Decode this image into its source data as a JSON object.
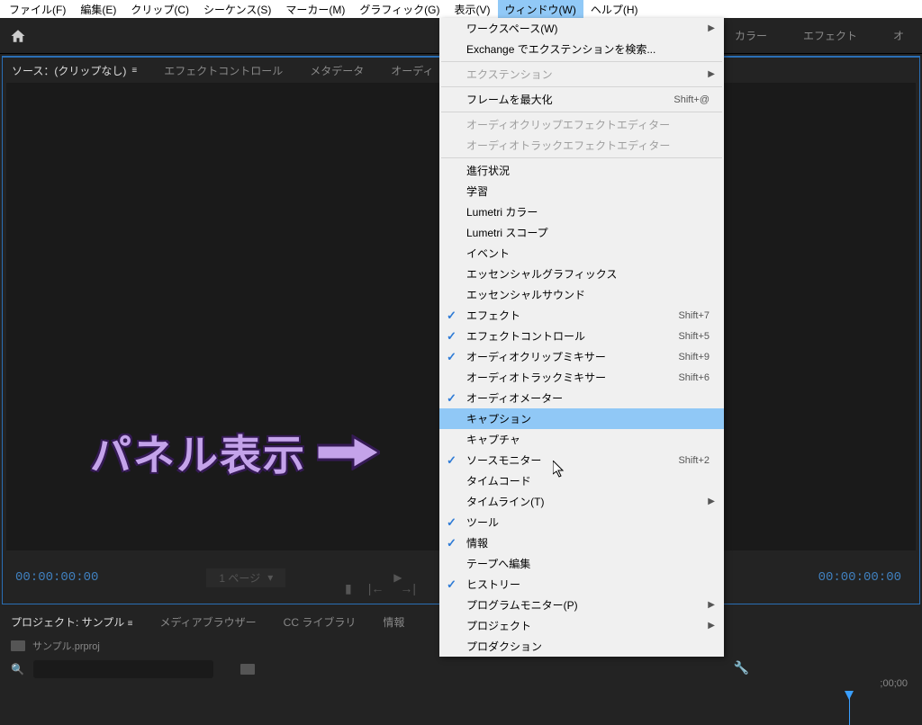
{
  "menubar": {
    "items": [
      {
        "label": "ファイル(F)"
      },
      {
        "label": "編集(E)"
      },
      {
        "label": "クリップ(C)"
      },
      {
        "label": "シーケンス(S)"
      },
      {
        "label": "マーカー(M)"
      },
      {
        "label": "グラフィック(G)"
      },
      {
        "label": "表示(V)"
      },
      {
        "label": "ウィンドウ(W)"
      },
      {
        "label": "ヘルプ(H)"
      }
    ]
  },
  "workspace_tabs": {
    "color": "カラー",
    "effects": "エフェクト",
    "audio": "オ"
  },
  "source_panel": {
    "tabs": {
      "source": "ソース：(クリップなし)",
      "effect_controls": "エフェクトコントロール",
      "metadata": "メタデータ",
      "audio": "オーディ"
    },
    "timecode_left": "00:00:00:00",
    "timecode_right": "00:00:00:00",
    "page_label": "1 ページ"
  },
  "project_panel": {
    "tabs": {
      "project": "プロジェクト: サンプル",
      "media_browser": "メディアブラウザー",
      "cc": "CC ライブラリ",
      "info": "情報"
    },
    "filename": "サンプル.prproj",
    "search_placeholder": ""
  },
  "timeline": {
    "ruler_tick": ";00;00"
  },
  "dropdown": {
    "items": [
      {
        "label": "ワークスペース(W)",
        "submenu": true
      },
      {
        "label": "Exchange でエクステンションを検索..."
      },
      {
        "sep": true
      },
      {
        "label": "エクステンション",
        "disabled": true,
        "submenu": true
      },
      {
        "sep": true
      },
      {
        "label": "フレームを最大化",
        "shortcut": "Shift+@"
      },
      {
        "sep": true
      },
      {
        "label": "オーディオクリップエフェクトエディター",
        "disabled": true
      },
      {
        "label": "オーディオトラックエフェクトエディター",
        "disabled": true
      },
      {
        "sep": true
      },
      {
        "label": "進行状況"
      },
      {
        "label": "学習"
      },
      {
        "label": "Lumetri カラー"
      },
      {
        "label": "Lumetri スコープ"
      },
      {
        "label": "イベント"
      },
      {
        "label": "エッセンシャルグラフィックス"
      },
      {
        "label": "エッセンシャルサウンド"
      },
      {
        "label": "エフェクト",
        "checked": true,
        "shortcut": "Shift+7"
      },
      {
        "label": "エフェクトコントロール",
        "checked": true,
        "shortcut": "Shift+5"
      },
      {
        "label": "オーディオクリップミキサー",
        "checked": true,
        "shortcut": "Shift+9"
      },
      {
        "label": "オーディオトラックミキサー",
        "shortcut": "Shift+6"
      },
      {
        "label": "オーディオメーター",
        "checked": true
      },
      {
        "label": "キャプション",
        "highlighted": true
      },
      {
        "label": "キャプチャ"
      },
      {
        "label": "ソースモニター",
        "checked": true,
        "shortcut": "Shift+2"
      },
      {
        "label": "タイムコード"
      },
      {
        "label": "タイムライン(T)",
        "submenu": true
      },
      {
        "label": "ツール",
        "checked": true
      },
      {
        "label": "情報",
        "checked": true
      },
      {
        "label": "テープへ編集"
      },
      {
        "label": "ヒストリー",
        "checked": true
      },
      {
        "label": "プログラムモニター(P)",
        "submenu": true
      },
      {
        "label": "プロジェクト",
        "submenu": true
      },
      {
        "label": "プロダクション"
      }
    ]
  },
  "annotation": {
    "text": "パネル表示"
  }
}
